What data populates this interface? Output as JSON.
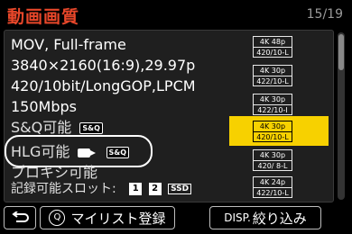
{
  "header": {
    "title": "動画画質",
    "page": "15/19"
  },
  "details": {
    "format": "MOV, Full-frame",
    "resolution": "3840×2160(16:9),29.97p",
    "codec": "420/10bit/LongGOP,LPCM",
    "bitrate": "150Mbps",
    "sq": "S&Q可能",
    "hlg": "HLG可能",
    "proxy": "プロキシ可能",
    "slots_label": "記録可能スロット:",
    "tags": {
      "sq": "S&Q",
      "slot1": "1",
      "slot2": "2",
      "ssd": "SSD"
    }
  },
  "codes": [
    {
      "top": "4K 48p",
      "bottom": "420/10-L",
      "selected": false
    },
    {
      "top": "4K 30p",
      "bottom": "422/10-L",
      "selected": false
    },
    {
      "top": "4K 30p",
      "bottom": "422/10-I",
      "selected": false
    },
    {
      "top": "4K 30p",
      "bottom": "420/10-L",
      "selected": true
    },
    {
      "top": "4K 30p",
      "bottom": "420/ 8-L",
      "selected": false
    },
    {
      "top": "4K 24p",
      "bottom": "422/10-L",
      "selected": false
    }
  ],
  "footer": {
    "back_icon": "return-arrow",
    "mylist_key": "Q",
    "mylist_label": "マイリスト登録",
    "disp_key": "DISP.",
    "narrow_label": "絞り込み"
  }
}
